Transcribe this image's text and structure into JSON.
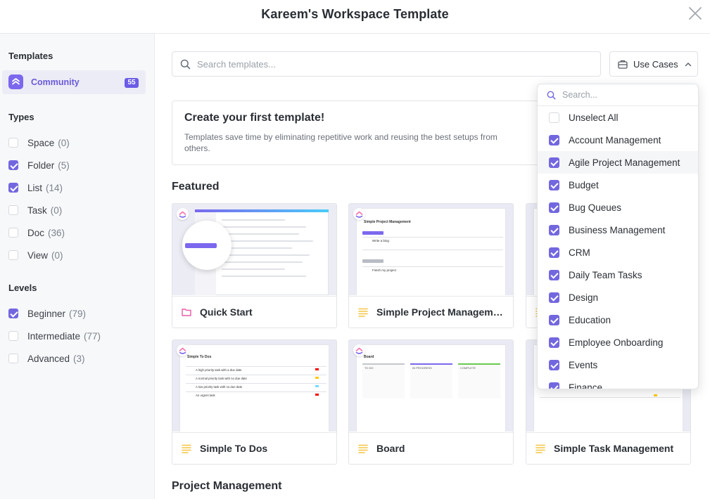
{
  "header": {
    "title": "Kareem's Workspace Template"
  },
  "sidebar": {
    "templates_title": "Templates",
    "community": {
      "label": "Community",
      "count": "55"
    },
    "types_title": "Types",
    "types": [
      {
        "label": "Space",
        "count": "(0)",
        "checked": false
      },
      {
        "label": "Folder",
        "count": "(5)",
        "checked": true
      },
      {
        "label": "List",
        "count": "(14)",
        "checked": true
      },
      {
        "label": "Task",
        "count": "(0)",
        "checked": false
      },
      {
        "label": "Doc",
        "count": "(36)",
        "checked": false
      },
      {
        "label": "View",
        "count": "(0)",
        "checked": false
      }
    ],
    "levels_title": "Levels",
    "levels": [
      {
        "label": "Beginner",
        "count": "(79)",
        "checked": true
      },
      {
        "label": "Intermediate",
        "count": "(77)",
        "checked": false
      },
      {
        "label": "Advanced",
        "count": "(3)",
        "checked": false
      }
    ]
  },
  "main": {
    "search_placeholder": "Search templates...",
    "use_cases_label": "Use Cases",
    "create": {
      "title": "Create your first template!",
      "desc": "Templates save time by eliminating repetitive work and reusing the best setups from others."
    },
    "featured_title": "Featured",
    "cards": [
      {
        "name": "Quick Start",
        "icon": "folder-icon"
      },
      {
        "name": "Simple Project Management",
        "icon": "list-icon",
        "thumb_title": "Simple Project Management",
        "rows": [
          "Write a blog",
          "Finish my project"
        ]
      },
      {
        "name": "",
        "icon": "list-icon"
      },
      {
        "name": "Simple To Dos",
        "icon": "list-icon",
        "thumb_title": "Simple To Dos",
        "rows": [
          "A high priority task with a due date",
          "A normal priority task with no due date",
          "A low priority task with no due date",
          "An urgent task"
        ]
      },
      {
        "name": "Board",
        "icon": "list-icon",
        "thumb_title": "Board",
        "cols": [
          "TO DO",
          "IN PROGRESS",
          "COMPLETE"
        ]
      },
      {
        "name": "Simple Task Management",
        "icon": "list-icon"
      }
    ],
    "pm_title": "Project Management"
  },
  "dropdown": {
    "search_placeholder": "Search...",
    "items": [
      {
        "label": "Unselect All",
        "checked": false
      },
      {
        "label": "Account Management",
        "checked": true
      },
      {
        "label": "Agile Project Management",
        "checked": true
      },
      {
        "label": "Budget",
        "checked": true
      },
      {
        "label": "Bug Queues",
        "checked": true
      },
      {
        "label": "Business Management",
        "checked": true
      },
      {
        "label": "CRM",
        "checked": true
      },
      {
        "label": "Daily Team Tasks",
        "checked": true
      },
      {
        "label": "Design",
        "checked": true
      },
      {
        "label": "Education",
        "checked": true
      },
      {
        "label": "Employee Onboarding",
        "checked": true
      },
      {
        "label": "Events",
        "checked": true
      },
      {
        "label": "Finance",
        "checked": true
      }
    ]
  },
  "colors": {
    "accent": "#7367e0",
    "brand": "#7b68ee",
    "list_icon": "#f4c542",
    "folder_icon": "#e85aa6"
  }
}
